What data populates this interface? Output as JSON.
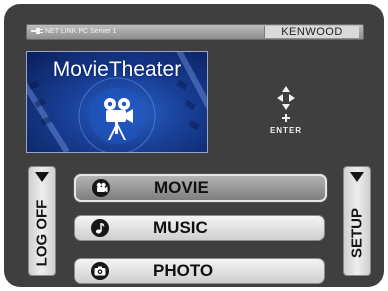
{
  "header": {
    "server_name": "NET LINK PC Server 1",
    "brand": "KENWOOD"
  },
  "banner": {
    "title": "MovieTheater"
  },
  "nav": {
    "enter_label": "ENTER"
  },
  "menu": {
    "items": [
      {
        "label": "MOVIE",
        "icon": "film-camera-icon",
        "selected": true
      },
      {
        "label": "MUSIC",
        "icon": "music-note-icon",
        "selected": false
      },
      {
        "label": "PHOTO",
        "icon": "camera-icon",
        "selected": false
      }
    ]
  },
  "side_buttons": {
    "logoff": "LOG OFF",
    "setup": "SETUP"
  },
  "colors": {
    "background": "#3f3f3f",
    "banner_blue": "#183e94",
    "button_light": "#e6e6e6",
    "button_selected": "#8e8e8e"
  }
}
